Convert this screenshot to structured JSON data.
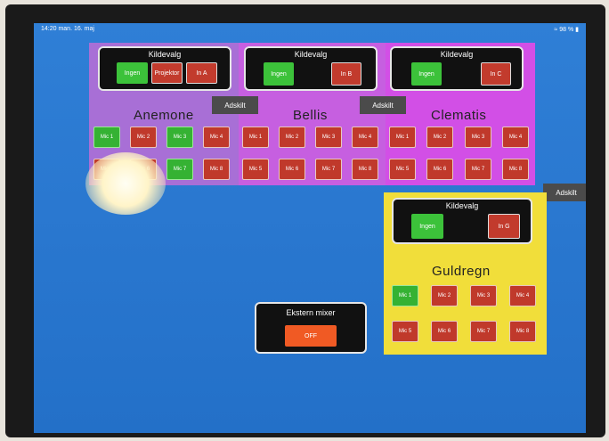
{
  "status": {
    "time": "14:20  man. 16. maj",
    "battery": "98 %"
  },
  "colors": {
    "purple": "#a86fd6",
    "magenta": "#d24fe6",
    "yellow": "#f1de3a",
    "active": "#35b233",
    "inactive": "#c0392b"
  },
  "zones": {
    "anemone": {
      "name": "Anemone",
      "source_title": "Kildevalg",
      "sources": [
        "Ingen",
        "Projektor",
        "In A"
      ],
      "mics": [
        "Mic 1",
        "Mic 2",
        "Mic 3",
        "Mic 4",
        "Mic 5",
        "Mic 6",
        "Mic 7",
        "Mic 8"
      ]
    },
    "bellis": {
      "name": "Bellis",
      "source_title": "Kildevalg",
      "sources": [
        "Ingen",
        "In B"
      ],
      "mics": [
        "Mic 1",
        "Mic 2",
        "Mic 3",
        "Mic 4",
        "Mic 5",
        "Mic 6",
        "Mic 7",
        "Mic 8"
      ]
    },
    "clematis": {
      "name": "Clematis",
      "source_title": "Kildevalg",
      "sources": [
        "Ingen",
        "In C"
      ],
      "mics": [
        "Mic 1",
        "Mic 2",
        "Mic 3",
        "Mic 4",
        "Mic 5",
        "Mic 6",
        "Mic 7",
        "Mic 8"
      ]
    },
    "guldregn": {
      "name": "Guldregn",
      "source_title": "Kildevalg",
      "sources": [
        "Ingen",
        "In G"
      ],
      "mics": [
        "Mic 1",
        "Mic 2",
        "Mic 3",
        "Mic 4",
        "Mic 5",
        "Mic 6",
        "Mic 7",
        "Mic 8"
      ]
    }
  },
  "adskilt": [
    "Adskilt",
    "Adskilt",
    "Adskilt"
  ],
  "mixer": {
    "title": "Ekstern mixer",
    "state": "OFF"
  }
}
